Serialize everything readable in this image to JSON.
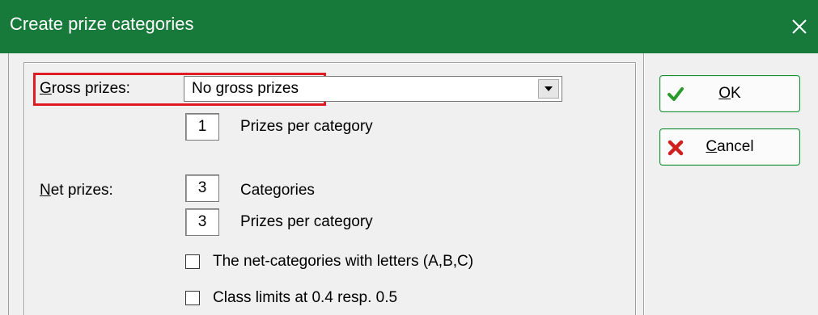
{
  "window": {
    "title": "Create prize categories",
    "close_glyph": "✕"
  },
  "gross": {
    "label_mnemonic": "G",
    "label_rest": "ross prizes:",
    "combo_value": "No gross prizes",
    "prizes_per_category_value": "1",
    "prizes_per_category_label": "Prizes per category"
  },
  "net": {
    "label_mnemonic": "N",
    "label_rest": "et prizes:",
    "categories_value": "3",
    "categories_label": "Categories",
    "prizes_per_category_value": "3",
    "prizes_per_category_label": "Prizes per category",
    "letters_checkbox_label": "The net-categories with letters (A,B,C)",
    "letters_checked": false,
    "class_limits_checkbox_label": "Class limits at 0.4 resp. 0.5",
    "class_limits_checked": false
  },
  "buttons": {
    "ok_mnemonic": "O",
    "ok_rest": "K",
    "cancel_mnemonic": "C",
    "cancel_rest": "ancel"
  },
  "colors": {
    "titlebar": "#177a3a",
    "highlight": "#e01b24",
    "ok_icon": "#2a9a2a",
    "cancel_icon": "#d11f1f"
  },
  "icons": {
    "close": "close-icon",
    "ok": "checkmark-icon",
    "cancel": "red-x-icon",
    "dropdown": "dropdown-arrow-icon"
  }
}
